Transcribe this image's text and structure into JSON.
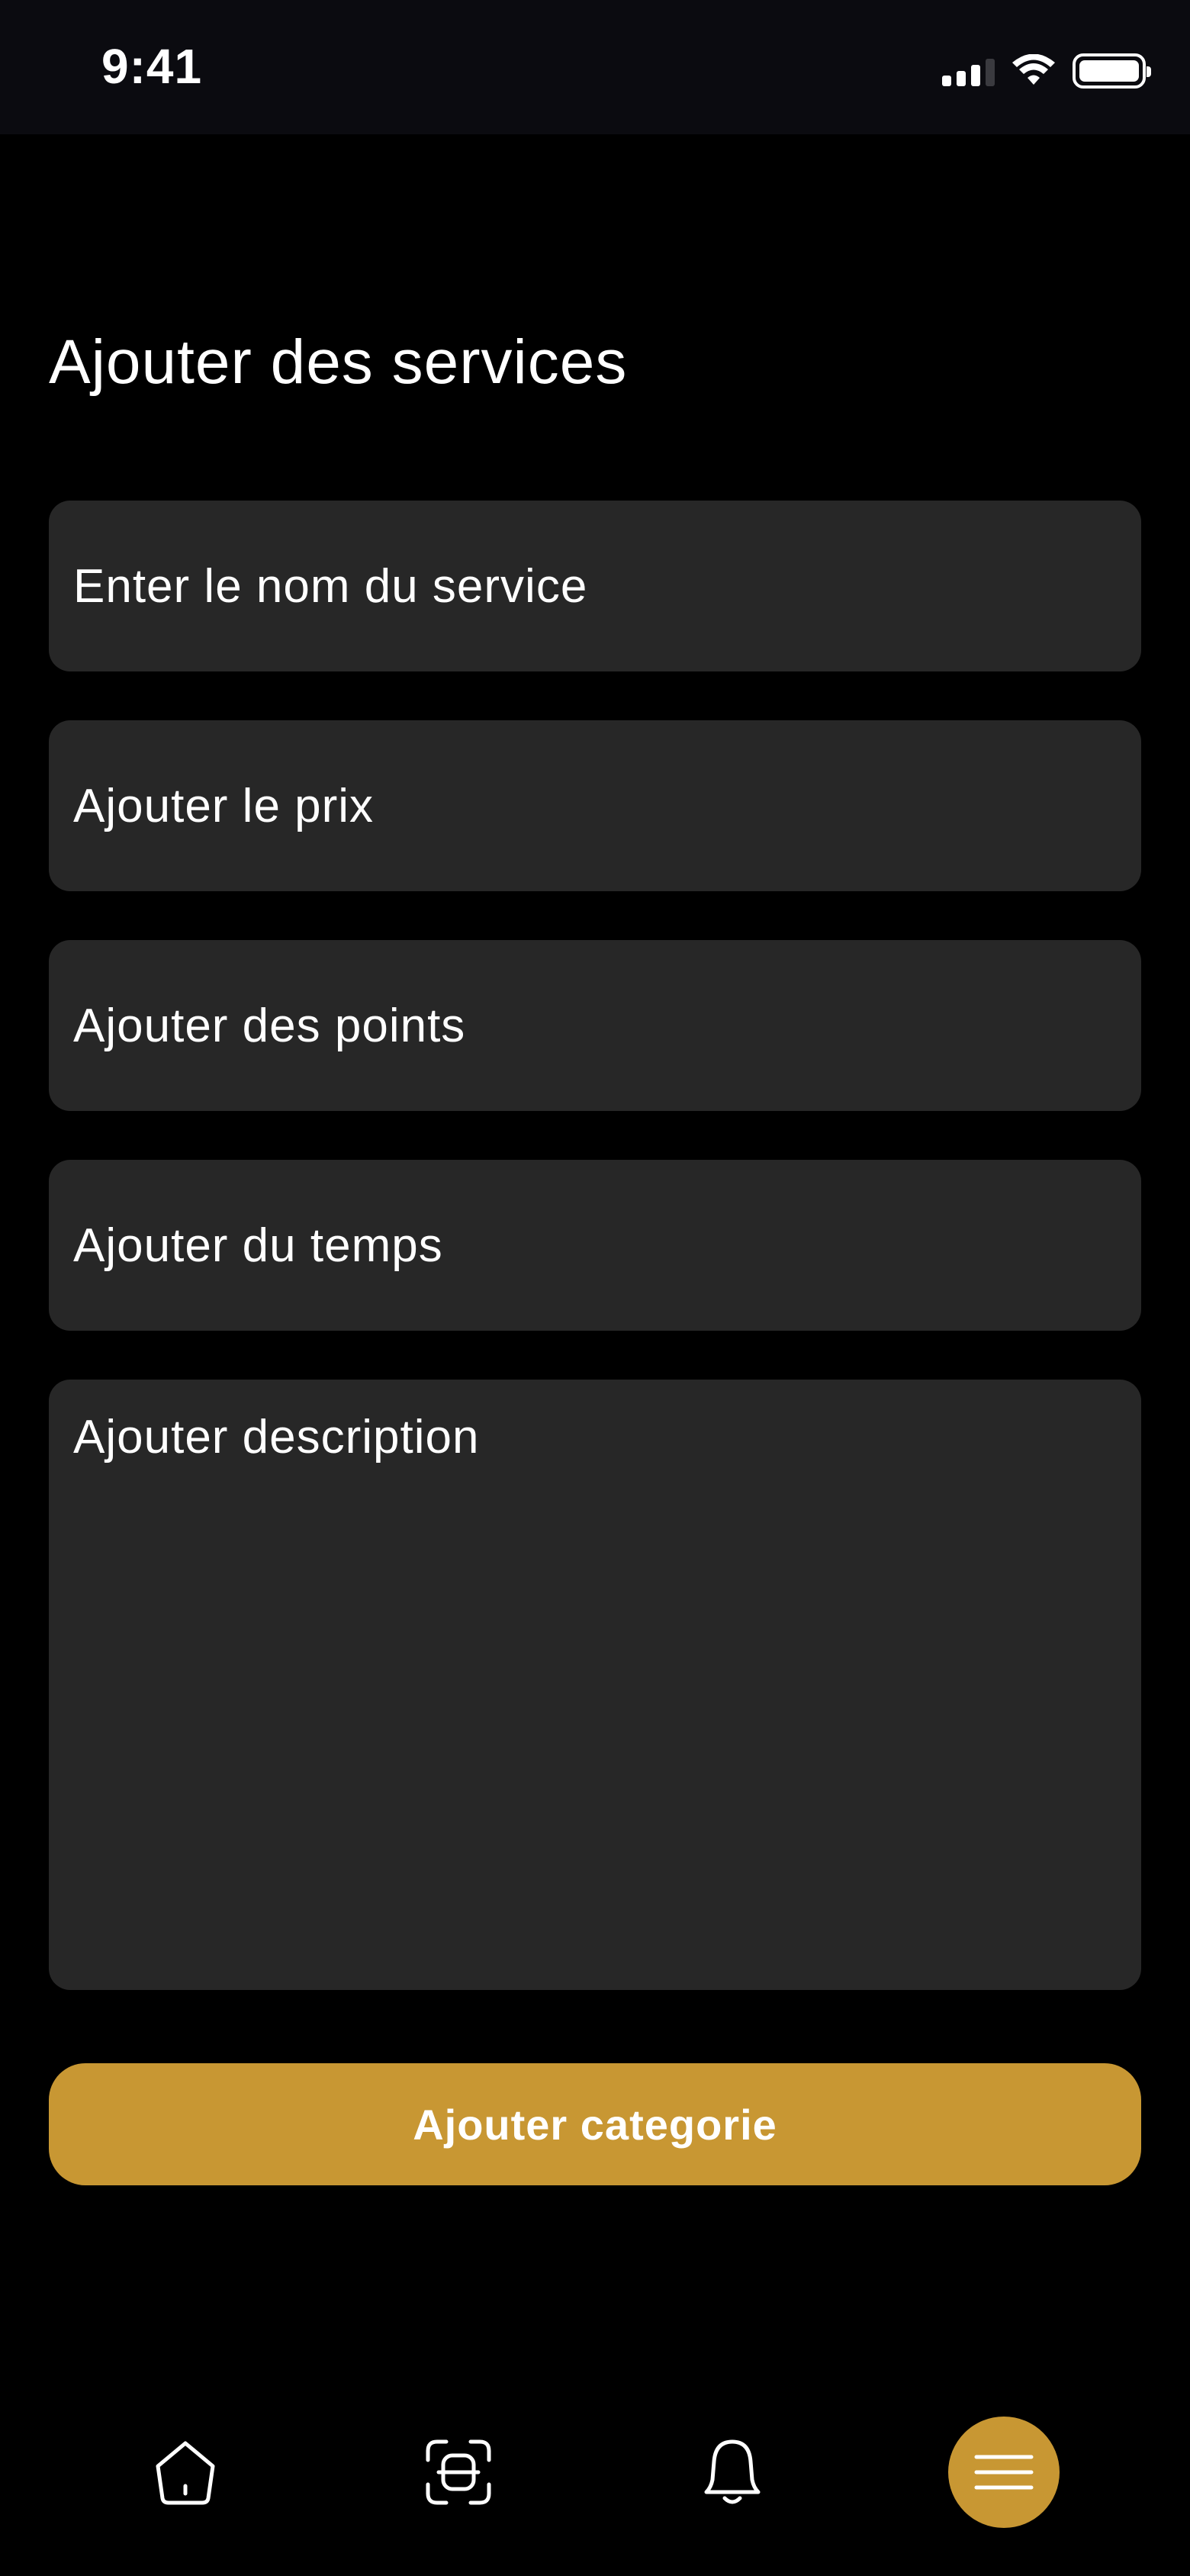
{
  "status_bar": {
    "time": "9:41"
  },
  "page": {
    "title": "Ajouter des services"
  },
  "form": {
    "service_name_placeholder": "Enter le nom du service",
    "price_placeholder": "Ajouter le prix",
    "points_placeholder": "Ajouter des points",
    "time_placeholder": "Ajouter du temps",
    "description_placeholder": "Ajouter description",
    "submit_label": "Ajouter categorie"
  },
  "nav": {
    "items": [
      {
        "icon": "home-icon",
        "active": false
      },
      {
        "icon": "scan-icon",
        "active": false
      },
      {
        "icon": "bell-icon",
        "active": false
      },
      {
        "icon": "menu-icon",
        "active": true
      }
    ]
  },
  "colors": {
    "background": "#000000",
    "field": "#272727",
    "accent": "#c89733",
    "text": "#ffffff"
  }
}
